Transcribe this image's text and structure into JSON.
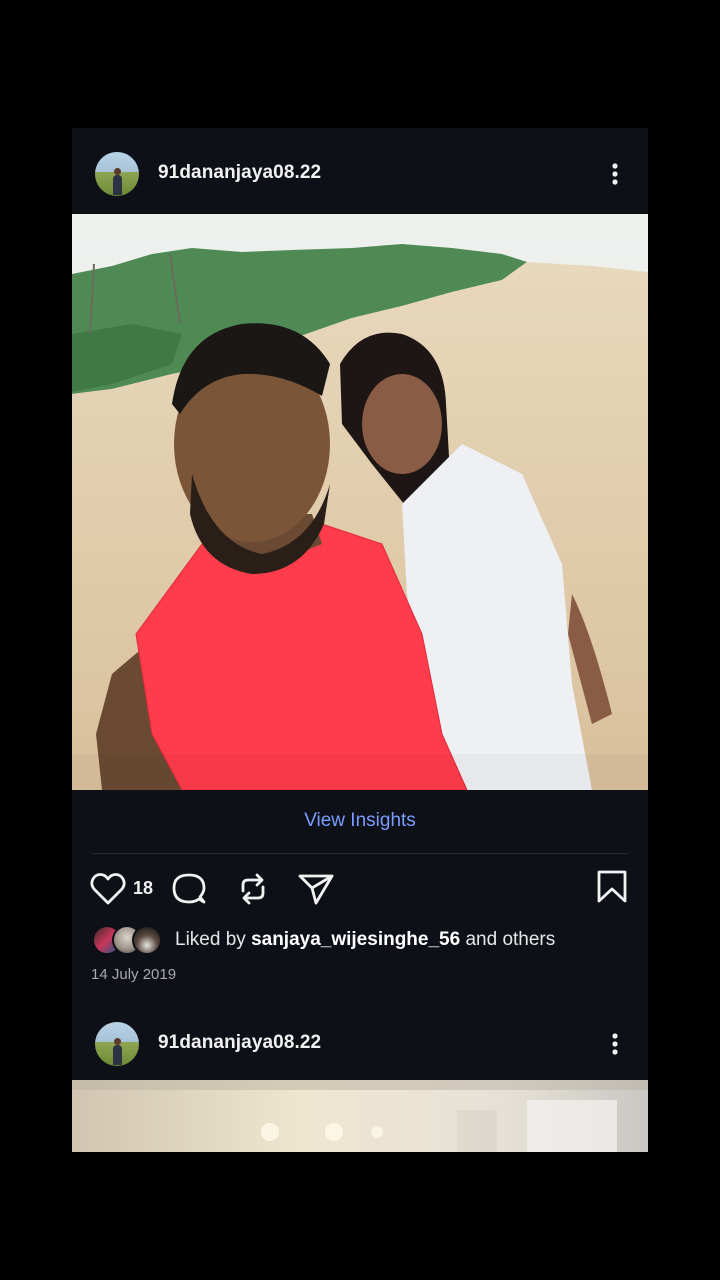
{
  "posts": [
    {
      "username": "91dananjaya08.22",
      "avatar": "profile-photo",
      "view_insights": "View Insights",
      "like_count": "18",
      "liked_by_prefix": "Liked by",
      "liked_by_user": "sanjaya_wijesinghe_56",
      "liked_by_suffix": "and others",
      "date": "14 July 2019"
    },
    {
      "username": "91dananjaya08.22",
      "avatar": "profile-photo"
    }
  ],
  "icons": {
    "more": "more-vertical-icon",
    "like": "heart-icon",
    "comment": "comment-icon",
    "repost": "repost-icon",
    "share": "send-icon",
    "save": "bookmark-icon"
  },
  "colors": {
    "background": "#0d1017",
    "accent_link": "#7b9cff",
    "shirt_red": "#ff3c4b"
  }
}
